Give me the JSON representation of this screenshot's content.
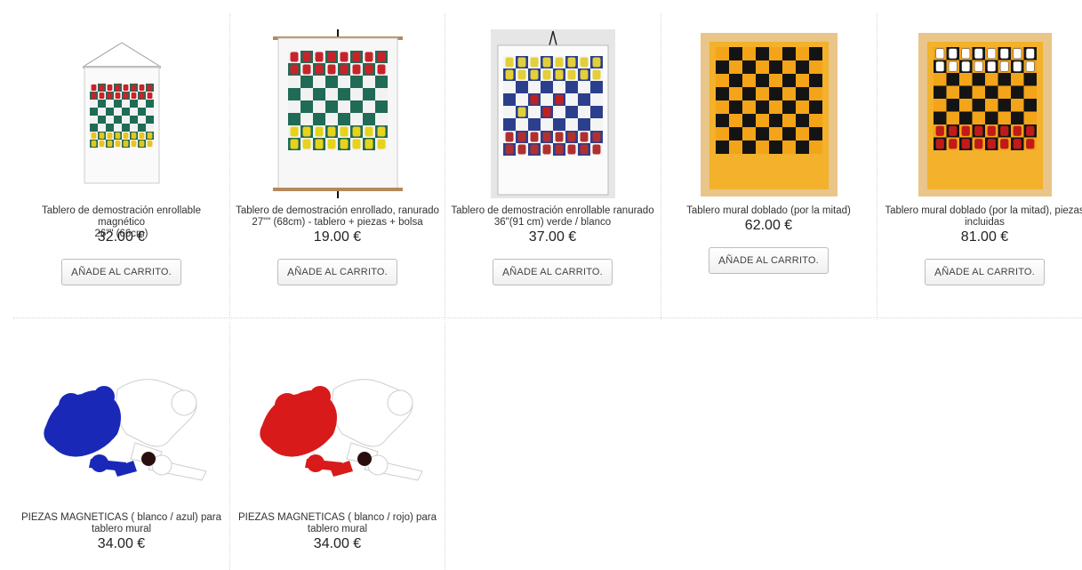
{
  "products": [
    {
      "title_line1": "Tablero de demostración enrollable magnético",
      "title_line2": "26\"\" (66cm)",
      "price": "32.00 €",
      "button_first": "A",
      "button_rest": "ÑADE AL CARRITO."
    },
    {
      "title_line1": "Tablero de demostración enrollado, ranurado",
      "title_line2": "27\"\" (68cm) - tablero + piezas + bolsa",
      "price": "19.00 €",
      "button_first": "A",
      "button_rest": "ÑADE AL CARRITO."
    },
    {
      "title_line1": "Tablero de demostración enrollable ranurado",
      "title_line2": "36\"(91 cm) verde / blanco",
      "price": "37.00 €",
      "button_first": "A",
      "button_rest": "ÑADE AL CARRITO."
    },
    {
      "title_line1": "Tablero mural doblado (por la mitad)",
      "title_line2": "",
      "price": "62.00 €",
      "button_first": "A",
      "button_rest": "ÑADE AL CARRITO."
    },
    {
      "title_line1": "Tablero mural doblado (por la mitad), piezas",
      "title_line2": "incluidas",
      "price": "81.00 €",
      "button_first": "A",
      "button_rest": "ÑADE AL CARRITO."
    },
    {
      "title_line1": "PIEZAS MAGNETICAS ( blanco / azul) para",
      "title_line2": "tablero mural",
      "price": "34.00 €"
    },
    {
      "title_line1": "PIEZAS MAGNETICAS ( blanco / rojo) para",
      "title_line2": "tablero mural",
      "price": "34.00 €"
    }
  ],
  "colors": {
    "green_square": "#1f6b55",
    "orange_square": "#f4a418",
    "blue_piece": "#1a28b8",
    "red_piece": "#d81a1a"
  }
}
